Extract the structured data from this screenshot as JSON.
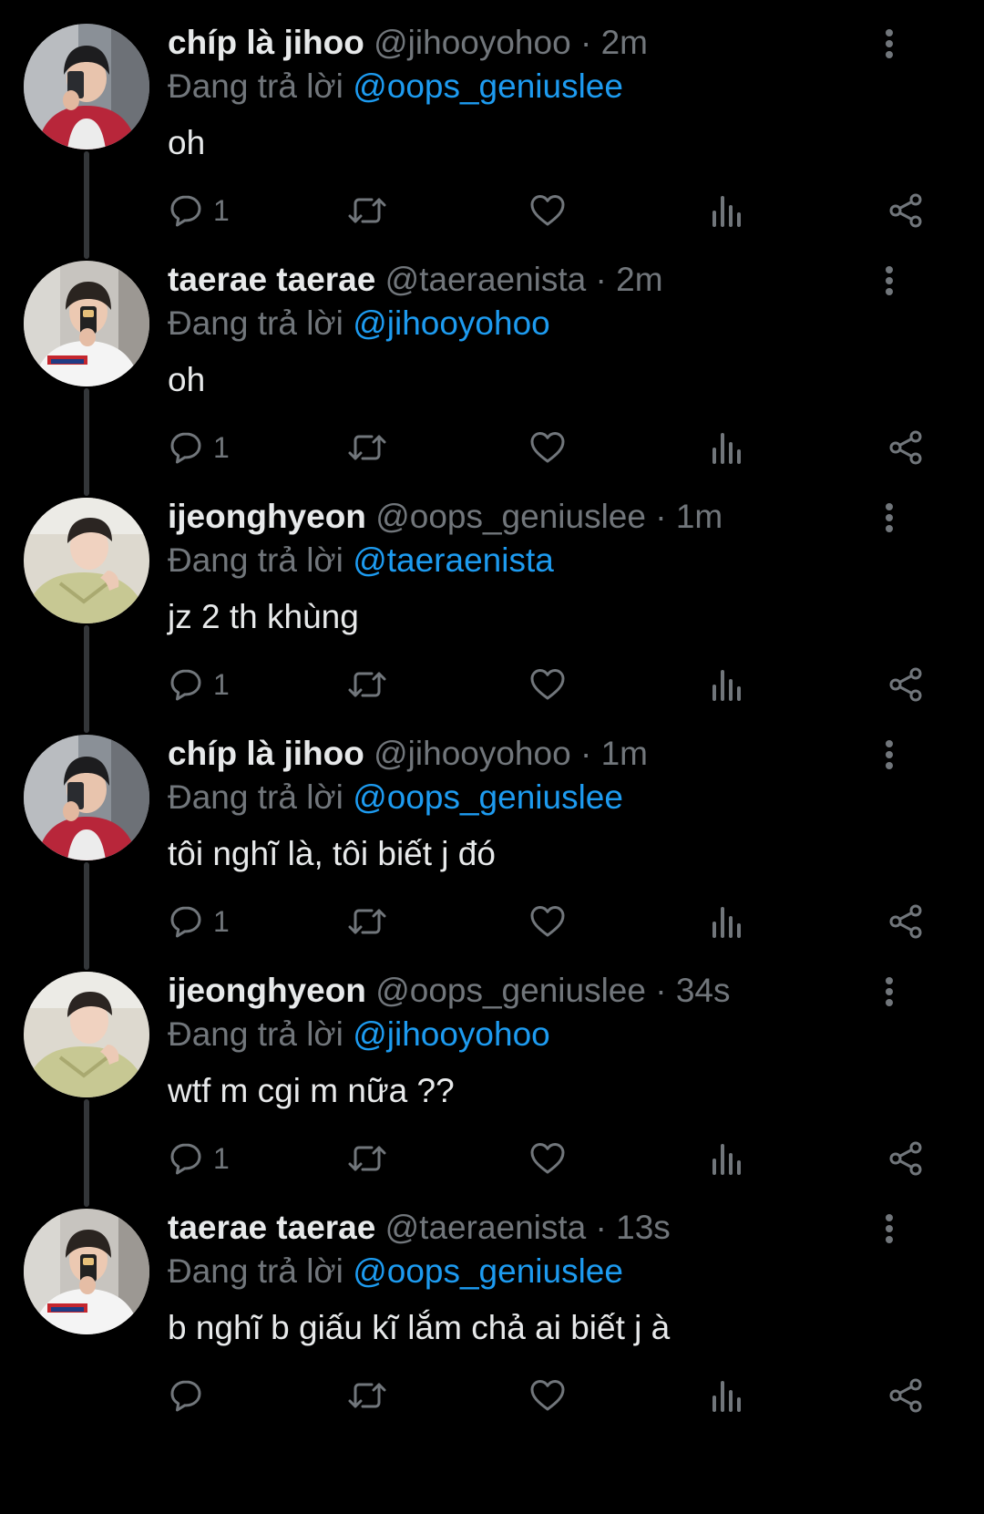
{
  "colors": {
    "background": "#000000",
    "text_primary": "#e7e9ea",
    "text_secondary": "#71767b",
    "accent": "#1d9bf0",
    "thread_line": "#333639"
  },
  "reply_prefix": "Đang trả lời",
  "tweets": [
    {
      "display_name": "chíp là jihoo",
      "handle": "@jihooyohoo",
      "time": "2m",
      "reply_to": "@oops_geniuslee",
      "text": "oh",
      "reply_count": "1",
      "avatar": "jihoo"
    },
    {
      "display_name": "taerae taerae",
      "handle": "@taeraenista",
      "time": "2m",
      "reply_to": "@jihooyohoo",
      "text": "oh",
      "reply_count": "1",
      "avatar": "taerae"
    },
    {
      "display_name": "ijeonghyeon",
      "handle": "@oops_geniuslee",
      "time": "1m",
      "reply_to": "@taeraenista",
      "text": "jz 2 th khùng",
      "reply_count": "1",
      "avatar": "jeonghyeon"
    },
    {
      "display_name": "chíp là jihoo",
      "handle": "@jihooyohoo",
      "time": "1m",
      "reply_to": "@oops_geniuslee",
      "text": "tôi nghĩ là, tôi biết j đó",
      "reply_count": "1",
      "avatar": "jihoo"
    },
    {
      "display_name": "ijeonghyeon",
      "handle": "@oops_geniuslee",
      "time": "34s",
      "reply_to": "@jihooyohoo",
      "text": "wtf m cgi m nữa ??",
      "reply_count": "1",
      "avatar": "jeonghyeon"
    },
    {
      "display_name": "taerae taerae",
      "handle": "@taeraenista",
      "time": "13s",
      "reply_to": "@oops_geniuslee",
      "text": "b nghĩ b giấu kĩ lắm chả ai biết j à",
      "reply_count": "",
      "avatar": "taerae"
    }
  ]
}
